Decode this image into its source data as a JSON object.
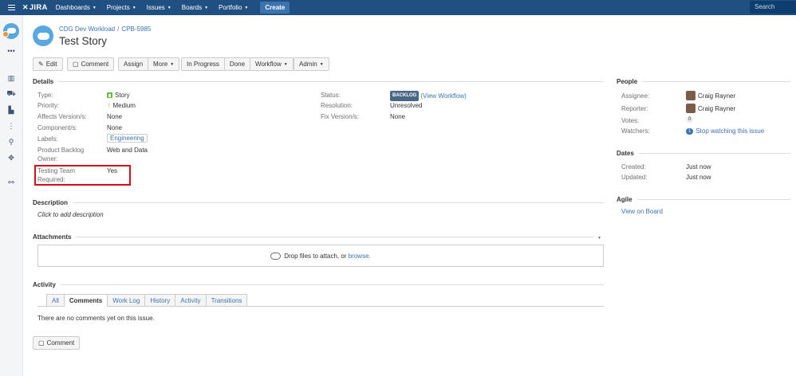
{
  "nav": {
    "logo": "JIRA",
    "items": [
      "Dashboards",
      "Projects",
      "Issues",
      "Boards",
      "Portfolio"
    ],
    "create_label": "Create",
    "search_placeholder": "Search"
  },
  "header": {
    "breadcrumb_project": "CDG Dev Workload",
    "breadcrumb_separator": "/",
    "breadcrumb_issue": "CPB-5985",
    "summary": "Test Story"
  },
  "toolbar": {
    "edit": "Edit",
    "comment": "Comment",
    "assign": "Assign",
    "more": "More",
    "in_progress": "In Progress",
    "done": "Done",
    "workflow": "Workflow",
    "admin": "Admin"
  },
  "details": {
    "heading": "Details",
    "type_label": "Type:",
    "type_value": "Story",
    "priority_label": "Priority:",
    "priority_value": "Medium",
    "affects_label": "Affects Version/s:",
    "affects_value": "None",
    "components_label": "Component/s:",
    "components_value": "None",
    "labels_label": "Labels:",
    "labels_value": "Engineering",
    "owner_label_1": "Product Backlog",
    "owner_label_2": "Owner:",
    "owner_value": "Web and Data",
    "testing_label_1": "Testing Team",
    "testing_label_2": "Required:",
    "testing_value": "Yes",
    "status_label": "Status:",
    "status_value": "BACKLOG",
    "status_link": "(View Workflow)",
    "resolution_label": "Resolution:",
    "resolution_value": "Unresolved",
    "fix_label": "Fix Version/s:",
    "fix_value": "None"
  },
  "description": {
    "heading": "Description",
    "placeholder": "Click to add description"
  },
  "attachments": {
    "heading": "Attachments",
    "drop_text": "Drop files to attach, or",
    "browse": "browse."
  },
  "activity": {
    "heading": "Activity",
    "tabs": [
      "All",
      "Comments",
      "Work Log",
      "History",
      "Activity",
      "Transitions"
    ],
    "empty": "There are no comments yet on this issue.",
    "comment_button": "Comment"
  },
  "people": {
    "heading": "People",
    "assignee_label": "Assignee:",
    "assignee_value": "Craig Rayner",
    "reporter_label": "Reporter:",
    "reporter_value": "Craig Rayner",
    "votes_label": "Votes:",
    "votes_value": "0",
    "watchers_label": "Watchers:",
    "watchers_count": "1",
    "watchers_link": "Stop watching this issue"
  },
  "dates": {
    "heading": "Dates",
    "created_label": "Created:",
    "created_value": "Just now",
    "updated_label": "Updated:",
    "updated_value": "Just now"
  },
  "agile": {
    "heading": "Agile",
    "link": "View on Board"
  },
  "colors": {
    "nav_bg": "#205081",
    "accent": "#3b73af",
    "highlight": "#d0101a"
  }
}
